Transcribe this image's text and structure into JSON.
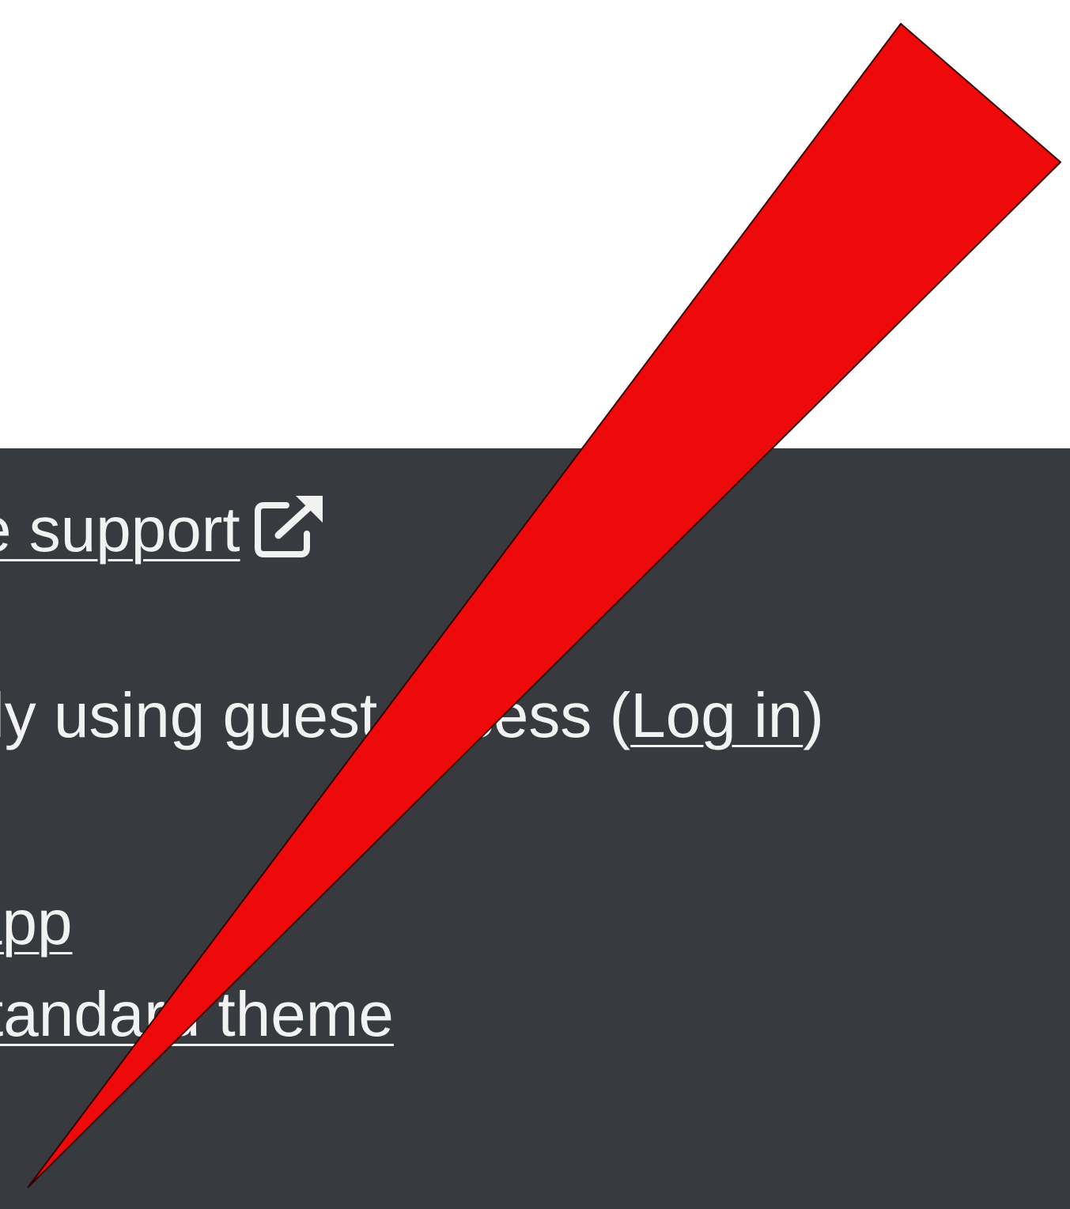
{
  "footer": {
    "support_link": "e support",
    "guest_text_before": "ly using gues",
    "guest_text_hidden": "t ac",
    "guest_text_after": "cess (",
    "login_link": "Log in",
    "guest_text_close": ")",
    "app_link": "app",
    "theme_link": "tandard theme",
    "external_link_icon": "external-link-icon",
    "background_color": "#373a3e",
    "text_color": "#f2f2f2"
  },
  "annotation": {
    "shape": "red-wedge-pointer",
    "fill_color": "#ee0a0a",
    "stroke_color": "#3a0000"
  }
}
